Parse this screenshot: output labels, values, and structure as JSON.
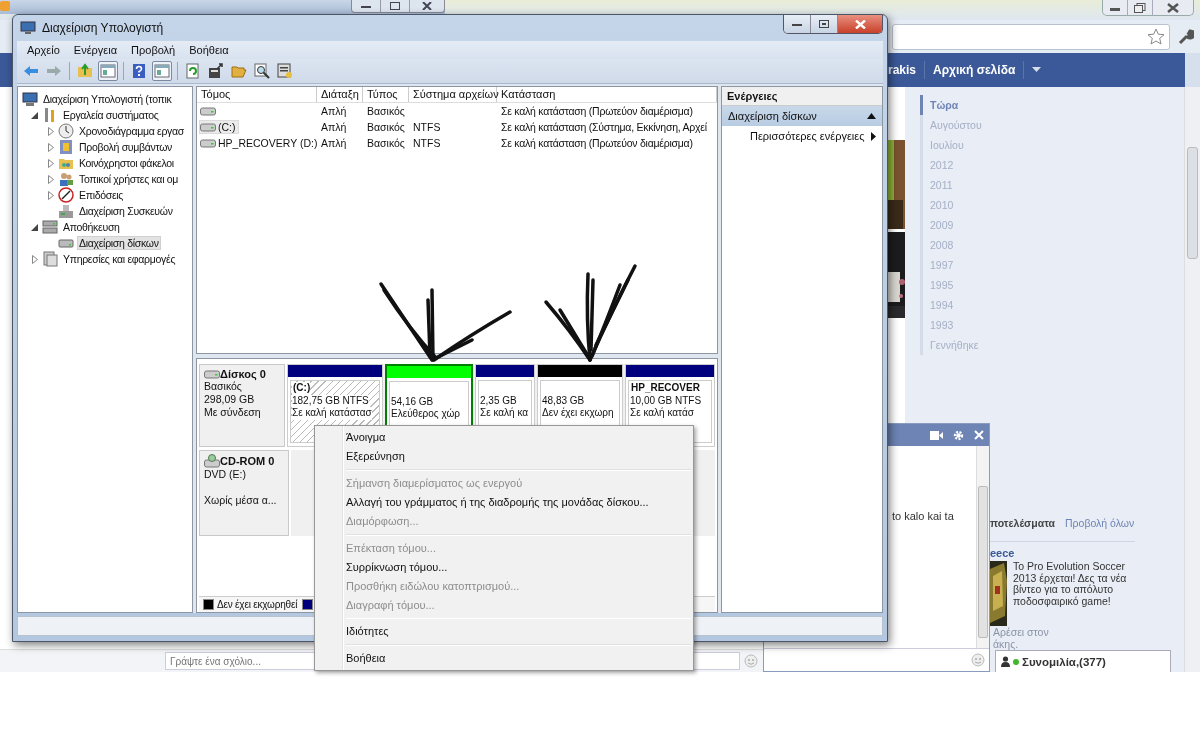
{
  "browser": {
    "nav": [
      "rakis",
      "Αρχική σελίδα"
    ],
    "timeline": [
      {
        "label": "Τώρα",
        "selected": true
      },
      {
        "label": "Αυγούστου",
        "selected": false
      },
      {
        "label": "Ιουλίου",
        "selected": false
      },
      {
        "label": "2012",
        "selected": false
      },
      {
        "label": "2011",
        "selected": false
      },
      {
        "label": "2010",
        "selected": false
      },
      {
        "label": "2009",
        "selected": false
      },
      {
        "label": "2008",
        "selected": false
      },
      {
        "label": "1997",
        "selected": false
      },
      {
        "label": "1995",
        "selected": false
      },
      {
        "label": "1994",
        "selected": false
      },
      {
        "label": "1993",
        "selected": false
      },
      {
        "label": "Γεννήθηκε",
        "selected": false
      }
    ],
    "comment": {
      "placeholder": "Γράψτε ένα σχόλιο..."
    },
    "chat": {
      "messages": [
        "to kalo kai ta"
      ]
    },
    "results": {
      "title": "ποτελέσματα",
      "link": "Προβολή όλων"
    },
    "ad": {
      "title": "eece",
      "text": "Το Pro Evolution Soccer 2013 έρχεται! Δες τα νέα βίντεο για το απόλυτο ποδοσφαιρικό game!"
    },
    "likes": [
      "Αρέσει στον",
      "άκης."
    ],
    "chat_bar": {
      "label": "Συνομιλία,(377)",
      "online": true
    }
  },
  "window": {
    "title": "Διαχείριση Υπολογιστή",
    "menu": [
      "Αρχείο",
      "Ενέργεια",
      "Προβολή",
      "Βοήθεια"
    ],
    "tree": [
      {
        "label": "Διαχείριση Υπολογιστή (τοπικ",
        "selected": false,
        "children": [
          {
            "label": "Εργαλεία συστήματος",
            "selected": false,
            "expanded": true,
            "children": [
              {
                "label": "Χρονοδιάγραμμα εργασ",
                "selected": false,
                "expanded": false
              },
              {
                "label": "Προβολή συμβάντων",
                "selected": false,
                "expanded": false
              },
              {
                "label": "Κοινόχρηστοι φάκελοι",
                "selected": false,
                "expanded": false
              },
              {
                "label": "Τοπικοί χρήστες και ομ",
                "selected": false,
                "expanded": false
              },
              {
                "label": "Επιδόσεις",
                "selected": false,
                "expanded": false
              },
              {
                "label": "Διαχείριση Συσκευών",
                "selected": false
              }
            ]
          },
          {
            "label": "Αποθήκευση",
            "selected": false,
            "expanded": true,
            "children": [
              {
                "label": "Διαχείριση δίσκων",
                "selected": true
              }
            ]
          },
          {
            "label": "Υπηρεσίες και εφαρμογές",
            "selected": false,
            "expanded": false
          }
        ]
      }
    ],
    "table": {
      "columns": [
        "Τόμος",
        "Διάταξη",
        "Τύπος",
        "Σύστημα αρχείων",
        "Κατάσταση"
      ],
      "rows": [
        {
          "layout": "Απλή",
          "type": "Βασικός",
          "status": "Σε καλή κατάσταση (Πρωτεύον διαμέρισμα)",
          "selected": false
        },
        {
          "volume": "(C:)",
          "layout": "Απλή",
          "type": "Βασικός",
          "file_system": "NTFS",
          "status": "Σε καλή κατάσταση (Σύστημα, Εκκίνηση, Αρχεί",
          "selected": true
        },
        {
          "volume": "HP_RECOVERY (D:)",
          "layout": "Απλή",
          "type": "Βασικός",
          "file_system": "NTFS",
          "status": "Σε καλή κατάσταση (Πρωτεύον διαμέρισμα)",
          "selected": false
        }
      ]
    },
    "disks": [
      {
        "name": "Δίσκος 0",
        "kind": "disk",
        "lines": [
          "Βασικός",
          "298,09 GB",
          "Με σύνδεση"
        ],
        "partitions": [
          {
            "name": "(C:)",
            "size": "182,75 GB NTFS",
            "status": "Σε καλή κατάστασ",
            "color": "#00007f",
            "kind": "primary",
            "selected": true
          },
          {
            "size": "54,16 GB",
            "status": "Ελεύθερος χώρ",
            "color": "#00ff00",
            "kind": "free",
            "selected": false
          },
          {
            "size": "2,35 GB",
            "status": "Σε καλή κα",
            "color": "#00007f",
            "kind": "primary",
            "selected": false
          },
          {
            "size": "48,83 GB",
            "status": "Δεν έχει εκχωρη",
            "color": "#000000",
            "kind": "unallocated",
            "selected": false
          },
          {
            "name": "HP_RECOVER",
            "size": "10,00 GB NTFS",
            "status": "Σε καλή κατάσ",
            "color": "#00007f",
            "kind": "primary",
            "selected": false
          }
        ]
      },
      {
        "name": "CD-ROM 0",
        "kind": "cdrom",
        "lines": [
          "DVD (E:)",
          "Χωρίς μέσα α..."
        ]
      }
    ],
    "legend": [
      {
        "label": "Δεν έχει εκχωρηθεί",
        "color": "#000000"
      },
      {
        "color": "#00007f"
      }
    ],
    "actions": {
      "title": "Ενέργειες",
      "section": {
        "label": "Διαχείριση δίσκων",
        "expanded": true
      },
      "items": [
        "Περισσότερες ενέργειες"
      ]
    }
  },
  "context_menu": [
    [
      {
        "label": "Άνοιγμα",
        "disabled": false
      },
      {
        "label": "Εξερεύνηση",
        "disabled": false
      }
    ],
    [
      {
        "label": "Σήμανση διαμερίσματος ως ενεργού",
        "disabled": true
      },
      {
        "label": "Αλλαγή  του γράμματος ή της διαδρομής της μονάδας δίσκου...",
        "disabled": false
      },
      {
        "label": "Διαμόρφωση...",
        "disabled": true
      }
    ],
    [
      {
        "label": "Επέκταση τόμου...",
        "disabled": true
      },
      {
        "label": "Συρρίκνωση τόμου...",
        "disabled": false
      },
      {
        "label": "Προσθήκη ειδώλου κατοπτρισμού...",
        "disabled": true
      },
      {
        "label": "Διαγραφή τόμου...",
        "disabled": true
      }
    ],
    [
      {
        "label": "Ιδιότητες",
        "disabled": false
      }
    ],
    [
      {
        "label": "Βοήθεια",
        "disabled": false
      }
    ]
  ]
}
